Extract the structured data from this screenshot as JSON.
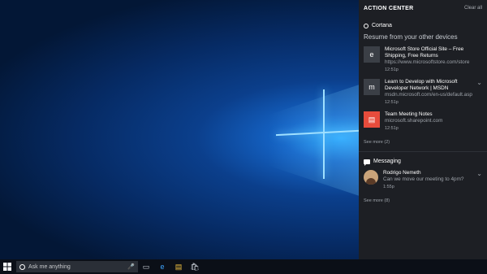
{
  "action_center": {
    "title": "ACTION CENTER",
    "clear_all": "Clear all",
    "cortana": {
      "label": "Cortana",
      "resume_text": "Resume from your other devices",
      "notifications": [
        {
          "title": "Microsoft Store Official Site – Free Shipping, Free Returns",
          "url": "https://www.microsoftstore.com/store",
          "time": "12:51p",
          "icon": "edge-icon"
        },
        {
          "title": "Learn to Develop with Microsoft Developer Network | MSDN",
          "url": "msdn.microsoft.com/en-us/default.asp",
          "time": "12:51p",
          "icon": "msdn-icon"
        },
        {
          "title": "Team Meeting Notes",
          "url": "microsoft.sharepoint.com",
          "time": "12:51p",
          "icon": "office-icon"
        }
      ],
      "see_more": "See more (2)"
    },
    "messaging": {
      "label": "Messaging",
      "message": {
        "sender": "Rodrigo Nemeth",
        "text": "Can we move our meeting to 4pm?",
        "time": "1:55p"
      },
      "see_more": "See more (8)"
    }
  },
  "taskbar": {
    "search_placeholder": "Ask me anything"
  }
}
